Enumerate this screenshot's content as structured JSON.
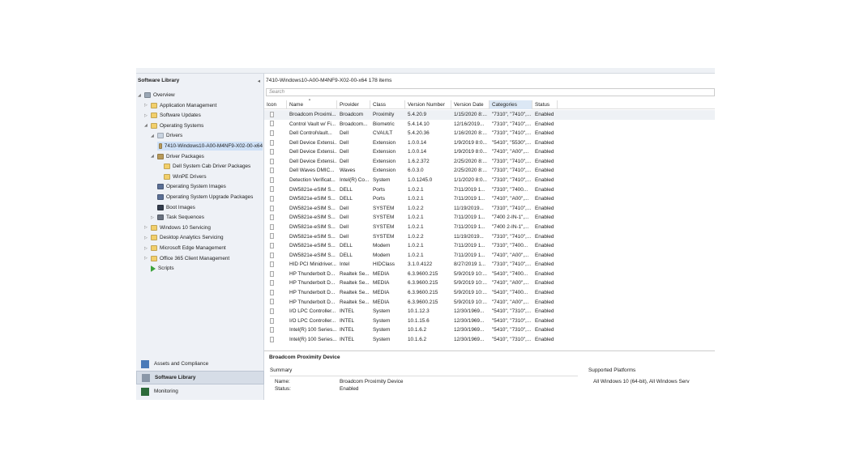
{
  "left": {
    "header": "Software Library",
    "tree": [
      {
        "label": "Overview",
        "level": 0,
        "arrow": "◢",
        "icon": "overview"
      },
      {
        "label": "Application Management",
        "level": 1,
        "arrow": "▷",
        "icon": "folder"
      },
      {
        "label": "Software Updates",
        "level": 1,
        "arrow": "▷",
        "icon": "folder"
      },
      {
        "label": "Operating Systems",
        "level": 1,
        "arrow": "◢",
        "icon": "folder"
      },
      {
        "label": "Drivers",
        "level": 2,
        "arrow": "◢",
        "icon": "driver"
      },
      {
        "label": "7410-Windows10-A00-M4NF9-X02-00-x64",
        "level": 3,
        "arrow": "",
        "icon": "package",
        "selected": true
      },
      {
        "label": "Driver Packages",
        "level": 2,
        "arrow": "◢",
        "icon": "package"
      },
      {
        "label": "Dell System Cab Driver Packages",
        "level": 3,
        "arrow": "",
        "icon": "folder"
      },
      {
        "label": "WinPE Drivers",
        "level": 3,
        "arrow": "",
        "icon": "folder"
      },
      {
        "label": "Operating System Images",
        "level": 2,
        "arrow": "",
        "icon": "image"
      },
      {
        "label": "Operating System Upgrade Packages",
        "level": 2,
        "arrow": "",
        "icon": "image"
      },
      {
        "label": "Boot Images",
        "level": 2,
        "arrow": "",
        "icon": "boot"
      },
      {
        "label": "Task Sequences",
        "level": 2,
        "arrow": "▷",
        "icon": "task"
      },
      {
        "label": "Windows 10 Servicing",
        "level": 1,
        "arrow": "▷",
        "icon": "folder"
      },
      {
        "label": "Desktop Analytics Servicing",
        "level": 1,
        "arrow": "▷",
        "icon": "folder"
      },
      {
        "label": "Microsoft Edge Management",
        "level": 1,
        "arrow": "▷",
        "icon": "folder"
      },
      {
        "label": "Office 365 Client Management",
        "level": 1,
        "arrow": "▷",
        "icon": "folder"
      },
      {
        "label": "Scripts",
        "level": 1,
        "arrow": "",
        "icon": "script"
      }
    ],
    "nav": [
      {
        "label": "Assets and Compliance"
      },
      {
        "label": "Software Library",
        "active": true
      },
      {
        "label": "Monitoring"
      }
    ]
  },
  "main": {
    "title": "7410-Windows10-A00-M4NF9-X02-00-x64 178 items",
    "search_placeholder": "Search",
    "columns": [
      "Icon",
      "Name",
      "Provider",
      "Class",
      "Version Number",
      "Version Date",
      "Categories",
      "Status"
    ],
    "rows": [
      [
        "Broadcom Proximi...",
        "Broadcom",
        "Proximity",
        "5.4.20.9",
        "1/15/2020 8:...",
        "\"7310\", \"7410\",...",
        "Enabled"
      ],
      [
        "Control Vault w/ Fi...",
        "Broadcom...",
        "Biometric",
        "5.4.14.10",
        "12/16/2019...",
        "\"7310\", \"7410\",...",
        "Enabled"
      ],
      [
        "Dell ControlVault...",
        "Dell",
        "CVAULT",
        "5.4.20.36",
        "1/16/2020 8:...",
        "\"7310\", \"7410\",...",
        "Enabled"
      ],
      [
        "Dell Device Extensi...",
        "Dell",
        "Extension",
        "1.0.0.14",
        "1/9/2019 8:0...",
        "\"5410\", \"5530\",...",
        "Enabled"
      ],
      [
        "Dell Device Extensi...",
        "Dell",
        "Extension",
        "1.0.0.14",
        "1/9/2019 8:0...",
        "\"7410\", \"A00\",...",
        "Enabled"
      ],
      [
        "Dell Device Extensi...",
        "Dell",
        "Extension",
        "1.6.2.372",
        "2/25/2020 8:...",
        "\"7310\", \"7410\",...",
        "Enabled"
      ],
      [
        "Dell Waves DMIC...",
        "Waves",
        "Extension",
        "6.0.3.0",
        "2/25/2020 8:...",
        "\"7310\", \"7410\",...",
        "Enabled"
      ],
      [
        "Detection Verificat...",
        "Intel(R) Co...",
        "System",
        "1.0.1245.0",
        "1/1/2020 8:0...",
        "\"7310\", \"7410\",...",
        "Enabled"
      ],
      [
        "DW5821e-eSIM S...",
        "DELL",
        "Ports",
        "1.0.2.1",
        "7/11/2019 1...",
        "\"7310\", \"7400...",
        "Enabled"
      ],
      [
        "DW5821e-eSIM S...",
        "DELL",
        "Ports",
        "1.0.2.1",
        "7/11/2019 1...",
        "\"7410\", \"A00\",...",
        "Enabled"
      ],
      [
        "DW5821e-eSIM S...",
        "Dell",
        "SYSTEM",
        "1.0.2.2",
        "11/19/2019...",
        "\"7310\", \"7410\",...",
        "Enabled"
      ],
      [
        "DW5821e-eSIM S...",
        "Dell",
        "SYSTEM",
        "1.0.2.1",
        "7/11/2019 1...",
        "\"7400 2-IN-1\",...",
        "Enabled"
      ],
      [
        "DW5821e-eSIM S...",
        "Dell",
        "SYSTEM",
        "1.0.2.1",
        "7/11/2019 1...",
        "\"7400 2-IN-1\",...",
        "Enabled"
      ],
      [
        "DW5821e-eSIM S...",
        "Dell",
        "SYSTEM",
        "1.0.2.2",
        "11/19/2019...",
        "\"7310\", \"7410\",...",
        "Enabled"
      ],
      [
        "DW5821e-eSIM S...",
        "DELL",
        "Modem",
        "1.0.2.1",
        "7/11/2019 1...",
        "\"7310\", \"7400...",
        "Enabled"
      ],
      [
        "DW5821e-eSIM S...",
        "DELL",
        "Modem",
        "1.0.2.1",
        "7/11/2019 1...",
        "\"7410\", \"A00\",...",
        "Enabled"
      ],
      [
        "HID PCI Minidriver...",
        "Intel",
        "HIDClass",
        "3.1.0.4122",
        "8/27/2019 1...",
        "\"7310\", \"7410\",...",
        "Enabled"
      ],
      [
        "HP Thunderbolt D...",
        "Realtek Se...",
        "MEDIA",
        "6.3.9600.215",
        "5/9/2019 10:...",
        "\"5410\", \"7400...",
        "Enabled"
      ],
      [
        "HP Thunderbolt D...",
        "Realtek Se...",
        "MEDIA",
        "6.3.9600.215",
        "5/9/2019 10:...",
        "\"7410\", \"A00\",...",
        "Enabled"
      ],
      [
        "HP Thunderbolt D...",
        "Realtek Se...",
        "MEDIA",
        "6.3.9600.215",
        "5/9/2019 10:...",
        "\"5410\", \"7400...",
        "Enabled"
      ],
      [
        "HP Thunderbolt D...",
        "Realtek Se...",
        "MEDIA",
        "6.3.9600.215",
        "5/9/2019 10:...",
        "\"7410\", \"A00\",...",
        "Enabled"
      ],
      [
        "I/O LPC Controller...",
        "INTEL",
        "System",
        "10.1.12.3",
        "12/30/1969...",
        "\"5410\", \"7310\",...",
        "Enabled"
      ],
      [
        "I/O LPC Controller...",
        "INTEL",
        "System",
        "10.1.15.6",
        "12/30/1969...",
        "\"5410\", \"7310\",...",
        "Enabled"
      ],
      [
        "Intel(R) 100 Series...",
        "INTEL",
        "System",
        "10.1.6.2",
        "12/30/1969...",
        "\"5410\", \"7310\",...",
        "Enabled"
      ],
      [
        "Intel(R) 100 Series...",
        "INTEL",
        "System",
        "10.1.6.2",
        "12/30/1969...",
        "\"5410\", \"7310\",...",
        "Enabled"
      ]
    ]
  },
  "detail": {
    "title": "Broadcom Proximity Device",
    "summary": "Summary",
    "supported_platforms": "Supported Platforms",
    "name_label": "Name:",
    "name_value": "Broadcom Proximity Device",
    "status_label": "Status:",
    "status_value": "Enabled",
    "platforms_value": "All Windows 10 (64-bit), All Windows Serv"
  }
}
